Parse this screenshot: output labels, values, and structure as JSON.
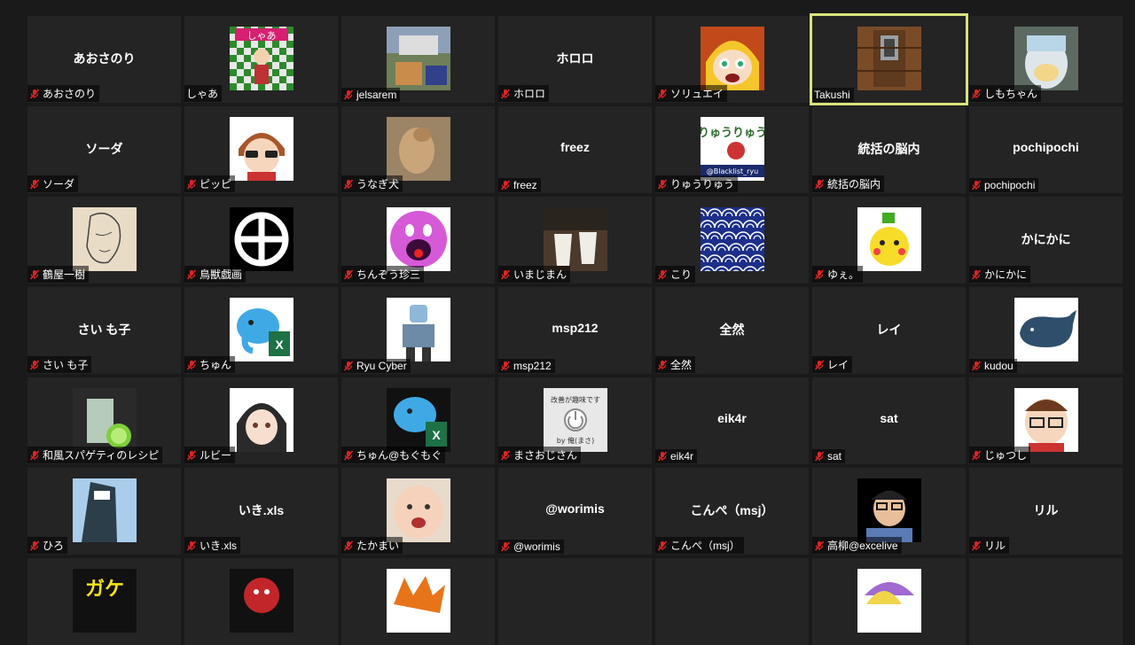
{
  "participants": [
    {
      "name": "あおさのり",
      "muted": true,
      "avatar": "none"
    },
    {
      "name": "しゃあ",
      "muted": false,
      "avatar": "checker-anime"
    },
    {
      "name": "jelsarem",
      "muted": true,
      "avatar": "photo-outdoor"
    },
    {
      "name": "ホロロ",
      "muted": true,
      "avatar": "none"
    },
    {
      "name": "ソリュエイ",
      "muted": true,
      "avatar": "anime-face"
    },
    {
      "name": "Takushi",
      "muted": false,
      "avatar": "wooden-door",
      "active": true
    },
    {
      "name": "しもちゃん",
      "muted": true,
      "avatar": "photo-plush"
    },
    {
      "name": "ソーダ",
      "muted": true,
      "avatar": "none"
    },
    {
      "name": "ピッピ",
      "muted": true,
      "avatar": "anime-glasses"
    },
    {
      "name": "うなぎ犬",
      "muted": true,
      "avatar": "photo-dog"
    },
    {
      "name": "freez",
      "muted": true,
      "avatar": "none"
    },
    {
      "name": "りゅうりゅう",
      "muted": true,
      "avatar": "ryu-logo"
    },
    {
      "name": "統括の脳内",
      "muted": true,
      "avatar": "none"
    },
    {
      "name": "pochipochi",
      "muted": true,
      "avatar": "none"
    },
    {
      "name": "鶴屋一樹",
      "muted": true,
      "avatar": "sketch"
    },
    {
      "name": "鳥獣戯画",
      "muted": true,
      "avatar": "cross-circle"
    },
    {
      "name": "ちんぞう珍三",
      "muted": true,
      "avatar": "pink-ball"
    },
    {
      "name": "いまじまん",
      "muted": true,
      "avatar": "photo-cups"
    },
    {
      "name": "こり",
      "muted": true,
      "avatar": "wave-pattern"
    },
    {
      "name": "ゆぇ。",
      "muted": true,
      "avatar": "pikachu"
    },
    {
      "name": "かにかに",
      "muted": true,
      "avatar": "none"
    },
    {
      "name": "さい も子",
      "muted": true,
      "avatar": "none"
    },
    {
      "name": "ちゅん",
      "muted": true,
      "avatar": "elephant-excel"
    },
    {
      "name": "Ryu Cyber",
      "muted": true,
      "avatar": "robot"
    },
    {
      "name": "msp212",
      "muted": true,
      "avatar": "none"
    },
    {
      "name": "全然",
      "muted": true,
      "avatar": "none"
    },
    {
      "name": "レイ",
      "muted": true,
      "avatar": "none"
    },
    {
      "name": "kudou",
      "muted": true,
      "avatar": "whale"
    },
    {
      "name": "和風スパゲティのレシピ",
      "muted": true,
      "avatar": "photo-drink"
    },
    {
      "name": "ルビー",
      "muted": true,
      "avatar": "anime-girl"
    },
    {
      "name": "ちゅん@もぐもぐ",
      "muted": true,
      "avatar": "elephant-excel-dark"
    },
    {
      "name": "まさおじさん",
      "muted": true,
      "avatar": "power-badge",
      "badge_top": "改善が趣味です",
      "badge_bottom": "by 俺(まさ)"
    },
    {
      "name": "eik4r",
      "muted": true,
      "avatar": "none"
    },
    {
      "name": "sat",
      "muted": true,
      "avatar": "none"
    },
    {
      "name": "じゅつし",
      "muted": true,
      "avatar": "man-glasses"
    },
    {
      "name": "ひろ",
      "muted": true,
      "avatar": "photo-building"
    },
    {
      "name": "いき.xls",
      "muted": true,
      "avatar": "none"
    },
    {
      "name": "たかまい",
      "muted": true,
      "avatar": "baby"
    },
    {
      "name": "@worimis",
      "muted": true,
      "avatar": "none"
    },
    {
      "name": "こんぺ（msj）",
      "muted": true,
      "avatar": "none"
    },
    {
      "name": "高柳@excelive",
      "muted": true,
      "avatar": "man-headset"
    },
    {
      "name": "リル",
      "muted": true,
      "avatar": "none"
    },
    {
      "name": "",
      "muted": false,
      "avatar": "yellow-text",
      "partial": true
    },
    {
      "name": "",
      "muted": false,
      "avatar": "red-character",
      "partial": true
    },
    {
      "name": "",
      "muted": false,
      "avatar": "orange-dragon",
      "partial": true
    },
    {
      "name": "",
      "muted": false,
      "avatar": "none",
      "partial": true
    },
    {
      "name": "",
      "muted": false,
      "avatar": "none",
      "partial": true
    },
    {
      "name": "",
      "muted": false,
      "avatar": "purple-anime",
      "partial": true
    },
    {
      "name": "",
      "muted": false,
      "avatar": "none",
      "partial": true
    }
  ],
  "avatar_text": {
    "checker-anime": "しゃあ",
    "ryu-logo-top": "りゅうりゅう",
    "ryu-logo-bottom": "@Blacklist_ryu",
    "yellow-text": "ガケ"
  },
  "colors": {
    "active_outline": "#d9e37a",
    "mute_red": "#e02424",
    "tile_bg": "#242424",
    "page_bg": "#1a1a1a"
  }
}
